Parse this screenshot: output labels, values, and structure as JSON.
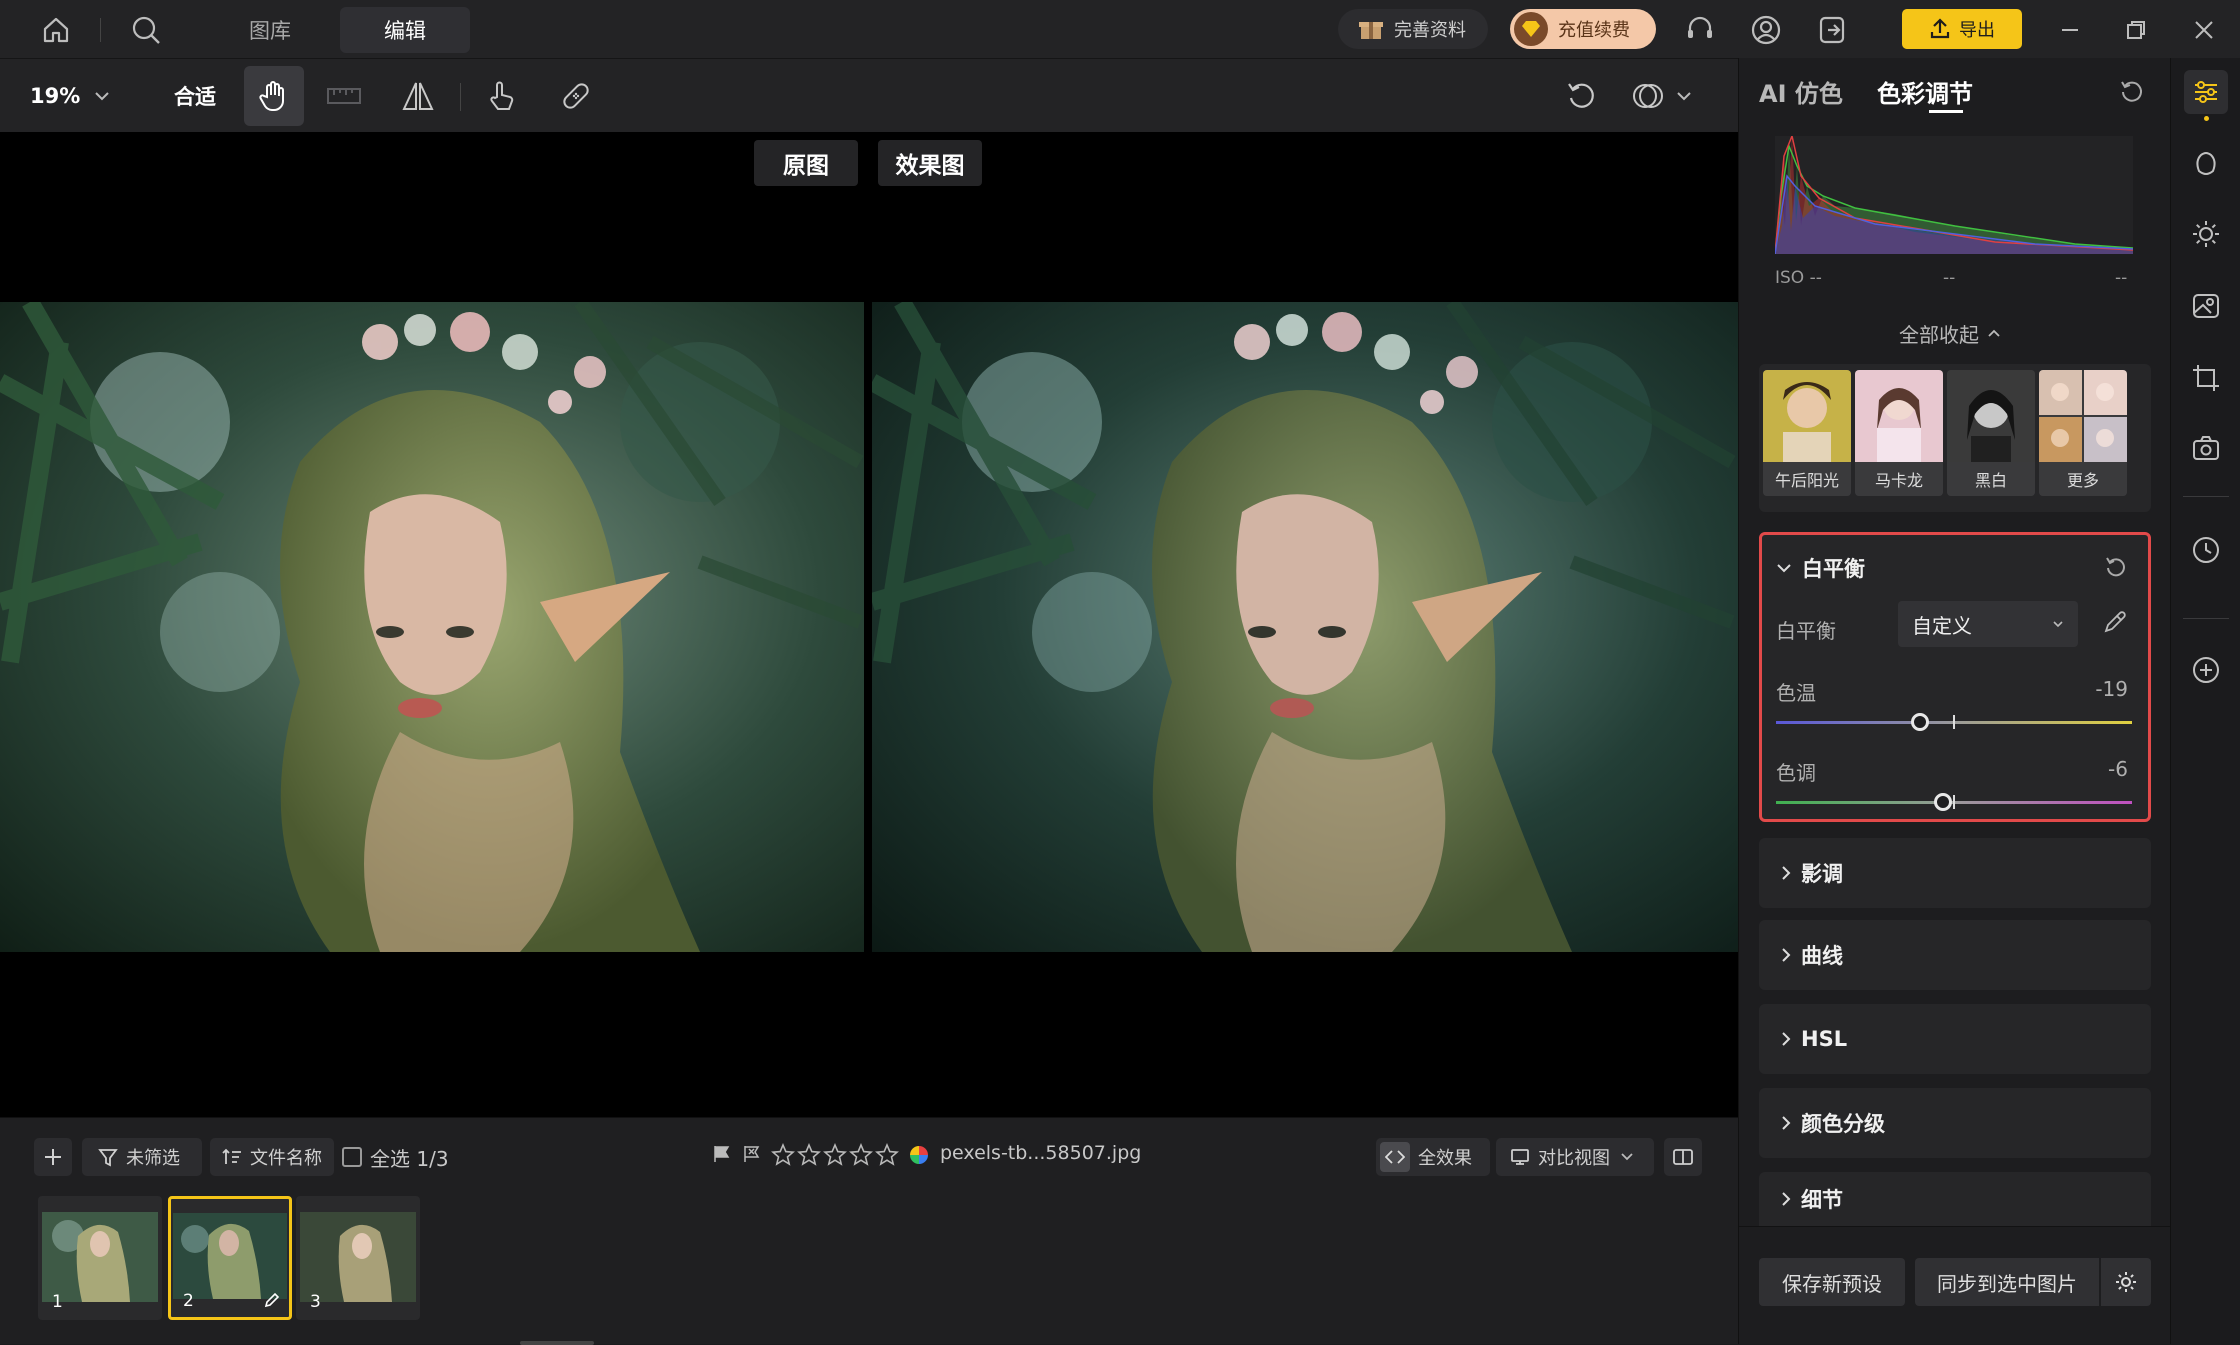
{
  "topbar": {
    "tabs": [
      "图库",
      "编辑"
    ],
    "profile_label": "完善资料",
    "recharge_label": "充值续费",
    "export_label": "导出"
  },
  "toolbar": {
    "zoom": "19%",
    "fit_label": "合适"
  },
  "canvas": {
    "original_label": "原图",
    "result_label": "效果图"
  },
  "bottom": {
    "filter_label": "未筛选",
    "sort_label": "文件名称",
    "select_all_label": "全选 1/3",
    "filename": "pexels-tb...58507.jpg",
    "full_effect_label": "全效果",
    "compare_view_label": "对比视图",
    "rating_max": 5,
    "rating": 0,
    "thumbnails": [
      {
        "index": "1",
        "selected": false
      },
      {
        "index": "2",
        "selected": true
      },
      {
        "index": "3",
        "selected": false
      }
    ]
  },
  "panel": {
    "tabs": [
      "AI 仿色",
      "色彩调节"
    ],
    "active_tab": "色彩调节",
    "iso_label": "ISO --",
    "meta_mid": "--",
    "meta_right": "--",
    "collapse_all": "全部收起",
    "presets": [
      "午后阳光",
      "马卡龙",
      "黑白",
      "更多"
    ],
    "white_balance": {
      "title": "白平衡",
      "mode_label": "白平衡",
      "mode_value": "自定义",
      "temp_label": "色温",
      "temp_value": "-19",
      "tint_label": "色调",
      "tint_value": "-6",
      "temp_range": [
        -100,
        100
      ],
      "tint_range": [
        -100,
        100
      ]
    },
    "sections": [
      "影调",
      "曲线",
      "HSL",
      "颜色分级",
      "细节"
    ],
    "save_preset": "保存新预设",
    "sync_label": "同步到选中图片"
  },
  "colors": {
    "accent": "#f5c518",
    "highlight_border": "#e24a4a"
  }
}
